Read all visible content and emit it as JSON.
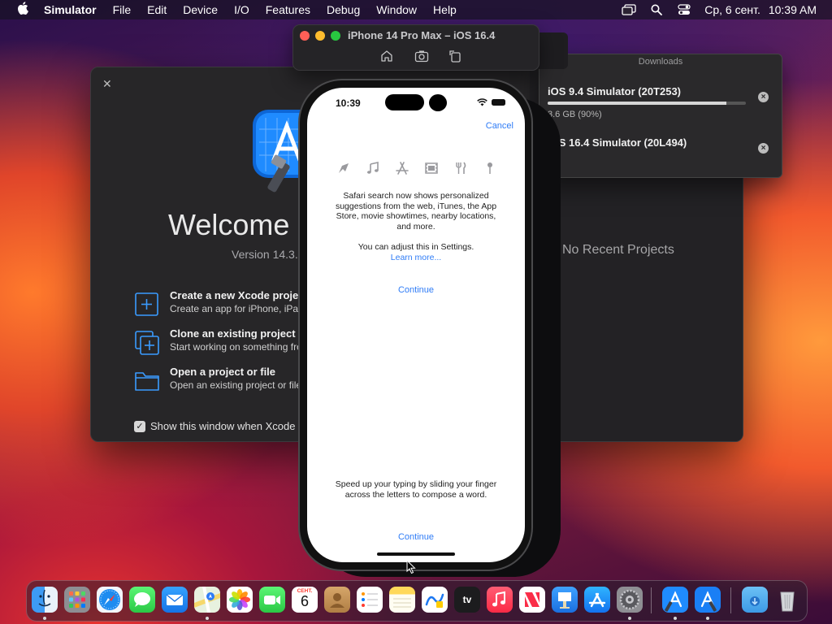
{
  "menubar": {
    "app_name": "Simulator",
    "menus": [
      "File",
      "Edit",
      "Device",
      "I/O",
      "Features",
      "Debug",
      "Window",
      "Help"
    ],
    "date": "Ср, 6 сент.",
    "time": "10:39 AM"
  },
  "xcode_welcome": {
    "title": "Welcome",
    "version": "Version 14.3.1",
    "options": [
      {
        "title": "Create a new Xcode project",
        "subtitle": "Create an app for iPhone, iPad, Mac, Apple Watch, or Apple TV.",
        "icon": "plus-square-icon"
      },
      {
        "title": "Clone an existing project",
        "subtitle": "Start working on something from a Git repository.",
        "icon": "clone-icon"
      },
      {
        "title": "Open a project or file",
        "subtitle": "Open an existing project or file on your Mac.",
        "icon": "folder-icon"
      }
    ],
    "show_window_label": "Show this window when Xcode launches",
    "show_window_checked": true,
    "no_recent": "No Recent Projects"
  },
  "downloads": {
    "title": "Downloads",
    "items": [
      {
        "name": "iOS 9.4 Simulator (20T253)",
        "status": "3.6 GB (90%)",
        "progress": 0.9
      },
      {
        "name": "iOS 16.4 Simulator (20L494)",
        "status": "",
        "progress": 0
      }
    ]
  },
  "simulator": {
    "title": "iPhone 14 Pro Max – iOS 16.4",
    "toolbar": [
      "home-icon",
      "screenshot-icon",
      "rotate-icon"
    ]
  },
  "phone": {
    "time": "10:39",
    "cancel": "Cancel",
    "category_icons": [
      "compass-icon",
      "music-icon",
      "app-store-icon",
      "film-icon",
      "fork-knife-icon",
      "map-pin-icon"
    ],
    "safari_text": "Safari search now shows personalized suggestions from the web, iTunes, the App Store, movie showtimes, nearby locations, and more.",
    "adjust_text": "You can adjust this in Settings.",
    "learn_more": "Learn more...",
    "continue_1": "Continue",
    "swipe_text": "Speed up your typing by sliding your finger across the letters to compose a word.",
    "continue_2": "Continue"
  },
  "dock": {
    "calendar_month": "СЕНТ.",
    "calendar_day": "6",
    "tv_label": "tv",
    "apps": [
      "finder",
      "launchpad",
      "safari",
      "messages",
      "mail",
      "maps",
      "photos",
      "facetime",
      "calendar",
      "contacts",
      "reminders",
      "notes",
      "freeform",
      "tv",
      "music",
      "news",
      "keynote",
      "app-store",
      "system-settings",
      "xcode",
      "xcode-beta",
      "downloads",
      "trash"
    ]
  },
  "colors": {
    "accent_blue": "#2f7cf6",
    "xcode_blue": "#1f8bff",
    "window_bg": "#272628"
  }
}
